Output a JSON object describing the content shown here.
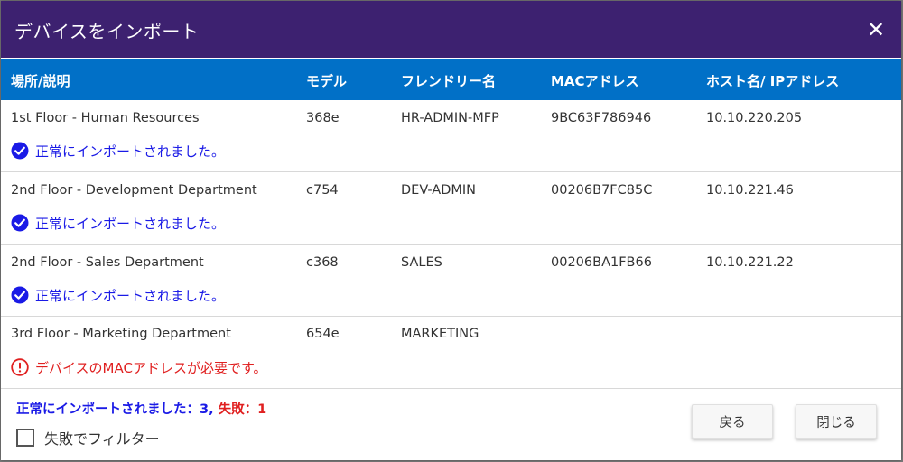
{
  "dialog": {
    "title": "デバイスをインポート",
    "close_glyph": "✕"
  },
  "table": {
    "headers": [
      "場所/説明",
      "モデル",
      "フレンドリー名",
      "MACアドレス",
      "ホスト名/ IPアドレス"
    ],
    "rows": [
      {
        "location": "1st Floor - Human Resources",
        "model": "368e",
        "friendly_name": "HR-ADMIN-MFP",
        "mac": "9BC63F786946",
        "host": "10.10.220.205",
        "status": "success",
        "message": "正常にインポートされました。"
      },
      {
        "location": "2nd Floor - Development Department",
        "model": "c754",
        "friendly_name": "DEV-ADMIN",
        "mac": "00206B7FC85C",
        "host": "10.10.221.46",
        "status": "success",
        "message": "正常にインポートされました。"
      },
      {
        "location": "2nd Floor - Sales Department",
        "model": "c368",
        "friendly_name": "SALES",
        "mac": "00206BA1FB66",
        "host": "10.10.221.22",
        "status": "success",
        "message": "正常にインポートされました。"
      },
      {
        "location": "3rd Floor - Marketing Department",
        "model": "654e",
        "friendly_name": "MARKETING",
        "mac": "",
        "host": "",
        "status": "error",
        "message": "デバイスのMACアドレスが必要です。"
      }
    ]
  },
  "footer": {
    "success_label": "正常にインポートされました：3,",
    "fail_label": "失敗：1",
    "filter_label": "失敗でフィルター",
    "filter_checked": false,
    "back_button": "戻る",
    "close_button": "閉じる"
  },
  "colors": {
    "title_bar": "#3d2170",
    "header_bar": "#0170c7",
    "success": "#1a1ae6",
    "error": "#e02020"
  },
  "icons": {
    "success": "check-circle-icon",
    "error": "exclamation-circle-icon",
    "close": "close-icon"
  }
}
